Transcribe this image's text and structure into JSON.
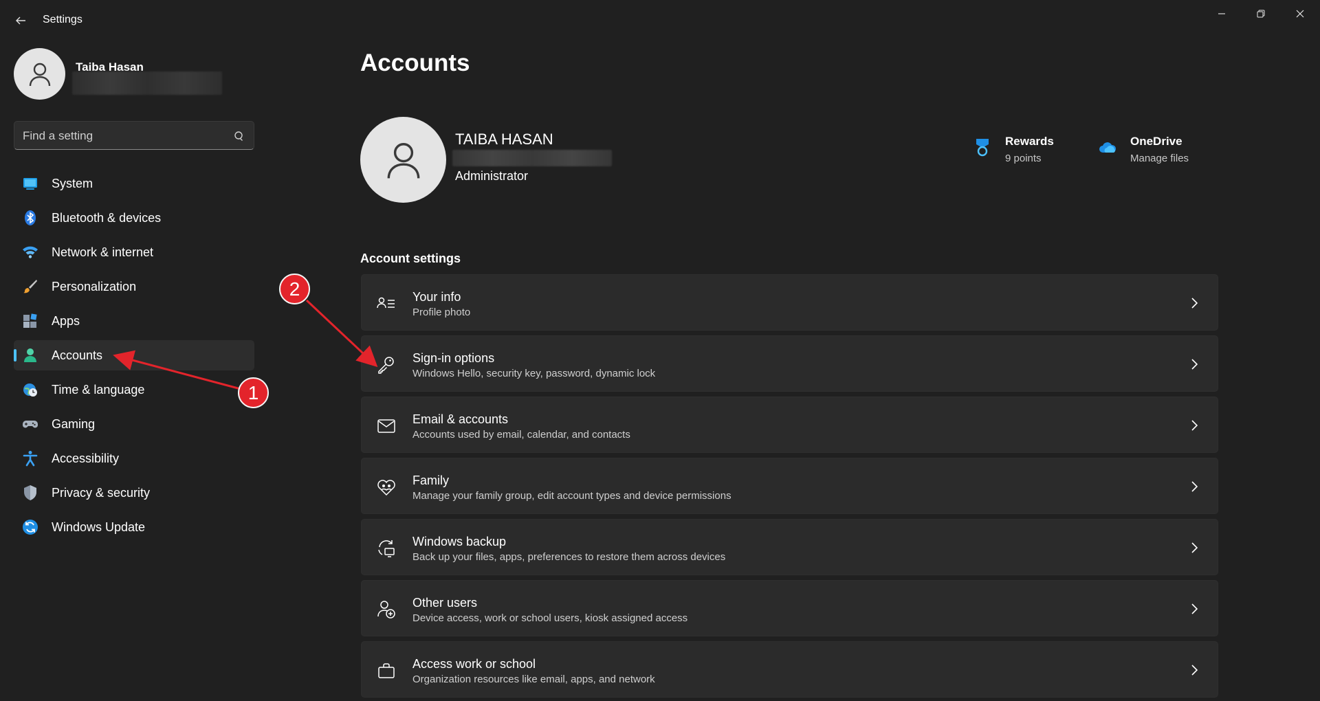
{
  "window": {
    "title": "Settings",
    "controls": {
      "minimize": "minimize-icon",
      "maximize": "restore-icon",
      "close": "close-icon"
    }
  },
  "sidebar": {
    "user_name": "Taiba Hasan",
    "search": {
      "placeholder": "Find a setting",
      "value": ""
    },
    "items": [
      {
        "label": "System",
        "icon": "system-icon",
        "active": false
      },
      {
        "label": "Bluetooth & devices",
        "icon": "bluetooth-icon",
        "active": false
      },
      {
        "label": "Network & internet",
        "icon": "wifi-icon",
        "active": false
      },
      {
        "label": "Personalization",
        "icon": "brush-icon",
        "active": false
      },
      {
        "label": "Apps",
        "icon": "apps-icon",
        "active": false
      },
      {
        "label": "Accounts",
        "icon": "accounts-icon",
        "active": true
      },
      {
        "label": "Time & language",
        "icon": "globe-clock-icon",
        "active": false
      },
      {
        "label": "Gaming",
        "icon": "gamepad-icon",
        "active": false
      },
      {
        "label": "Accessibility",
        "icon": "accessibility-icon",
        "active": false
      },
      {
        "label": "Privacy & security",
        "icon": "shield-icon",
        "active": false
      },
      {
        "label": "Windows Update",
        "icon": "update-icon",
        "active": false
      }
    ]
  },
  "main": {
    "title": "Accounts",
    "account": {
      "name": "TAIBA HASAN",
      "role": "Administrator"
    },
    "quick_links": {
      "rewards": {
        "title": "Rewards",
        "subtitle": "9 points"
      },
      "onedrive": {
        "title": "OneDrive",
        "subtitle": "Manage files"
      }
    },
    "section_title": "Account settings",
    "cards": [
      {
        "title": "Your info",
        "subtitle": "Profile photo",
        "icon": "person-card-icon"
      },
      {
        "title": "Sign-in options",
        "subtitle": "Windows Hello, security key, password, dynamic lock",
        "icon": "key-icon"
      },
      {
        "title": "Email & accounts",
        "subtitle": "Accounts used by email, calendar, and contacts",
        "icon": "mail-icon"
      },
      {
        "title": "Family",
        "subtitle": "Manage your family group, edit account types and device permissions",
        "icon": "family-heart-icon"
      },
      {
        "title": "Windows backup",
        "subtitle": "Back up your files, apps, preferences to restore them across devices",
        "icon": "backup-icon"
      },
      {
        "title": "Other users",
        "subtitle": "Device access, work or school users, kiosk assigned access",
        "icon": "add-person-icon"
      },
      {
        "title": "Access work or school",
        "subtitle": "Organization resources like email, apps, and network",
        "icon": "briefcase-icon"
      }
    ]
  },
  "annotations": {
    "badge_1": "1",
    "badge_2": "2",
    "color": "#e3242b"
  },
  "colors": {
    "background": "#202020",
    "card": "#2b2b2b",
    "accent": "#4cc2ff"
  }
}
